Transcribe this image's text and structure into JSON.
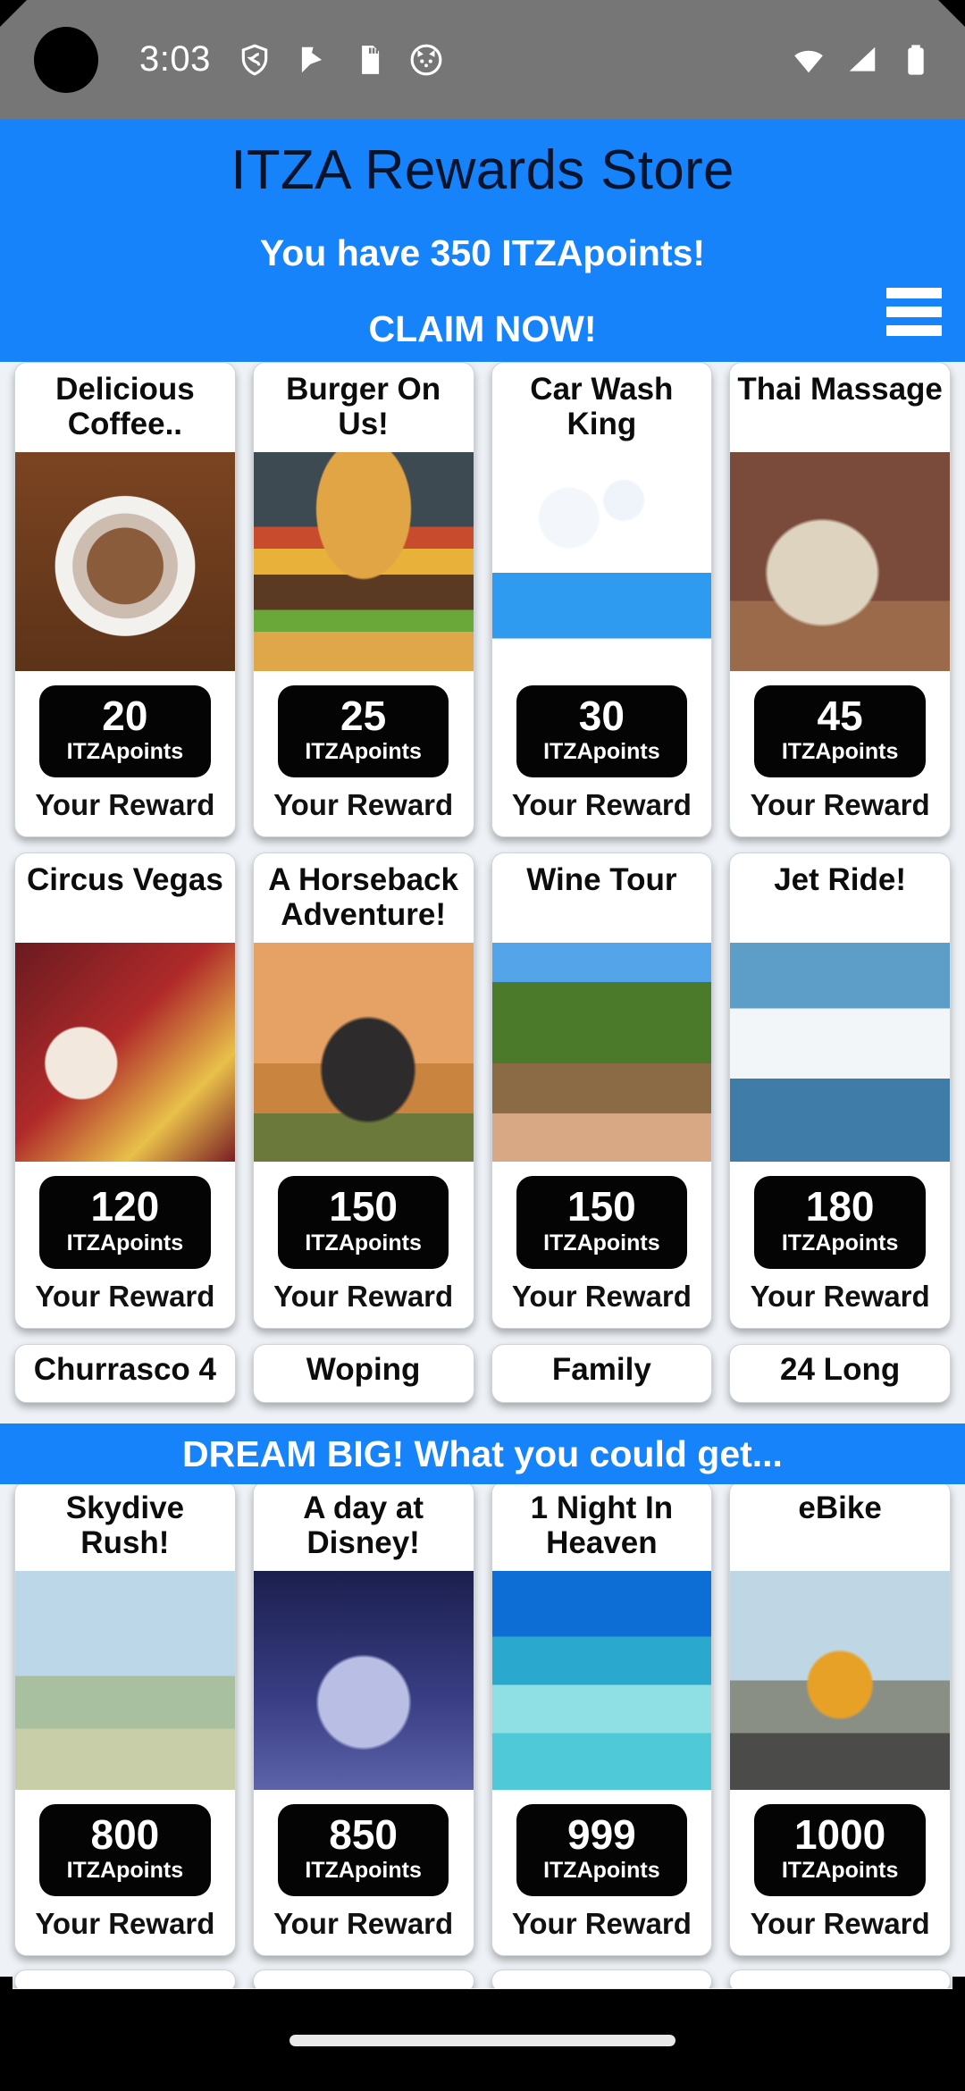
{
  "status_bar": {
    "time": "3:03",
    "left_icons": [
      "shield-icon",
      "flag-icon",
      "sd-card-icon",
      "cat-face-icon"
    ],
    "right_icons": [
      "wifi-icon",
      "cellular-signal-icon",
      "battery-icon"
    ]
  },
  "header": {
    "title": "ITZA Rewards Store",
    "points_line": "You have 350 ITZApoints!",
    "claim_label": "CLAIM NOW!",
    "menu_icon": "hamburger-menu-icon",
    "background_color": "#1683fb",
    "title_color": "#07142c"
  },
  "banner": {
    "text": "DREAM BIG! What you could get...",
    "background_color": "#1683fb"
  },
  "labels": {
    "points_unit": "ITZApoints",
    "reward_caption": "Your Reward"
  },
  "rewards_rows": [
    [
      {
        "title": "Delicious Coffee..",
        "points": "20",
        "unit": "ITZApoints",
        "caption": "Your Reward",
        "art": "g-coffee"
      },
      {
        "title": "Burger On Us!",
        "points": "25",
        "unit": "ITZApoints",
        "caption": "Your Reward",
        "art": "g-burger"
      },
      {
        "title": "Car Wash King",
        "points": "30",
        "unit": "ITZApoints",
        "caption": "Your Reward",
        "art": "g-carwash"
      },
      {
        "title": "Thai Massage",
        "points": "45",
        "unit": "ITZApoints",
        "caption": "Your Reward",
        "art": "g-massage"
      }
    ],
    [
      {
        "title": "Circus Vegas",
        "points": "120",
        "unit": "ITZApoints",
        "caption": "Your Reward",
        "art": "g-circus"
      },
      {
        "title": "A Horseback Adventure!",
        "points": "150",
        "unit": "ITZApoints",
        "caption": "Your Reward",
        "art": "g-horse"
      },
      {
        "title": "Wine Tour",
        "points": "150",
        "unit": "ITZApoints",
        "caption": "Your Reward",
        "art": "g-wine"
      },
      {
        "title": "Jet Ride!",
        "points": "180",
        "unit": "ITZApoints",
        "caption": "Your Reward",
        "art": "g-jet"
      }
    ]
  ],
  "rewards_partial_row": [
    {
      "title": "Churrasco 4"
    },
    {
      "title": "Woping"
    },
    {
      "title": "Family"
    },
    {
      "title": "24 Long"
    }
  ],
  "dream_rows": [
    [
      {
        "title": "Skydive Rush!",
        "points": "800",
        "unit": "ITZApoints",
        "caption": "Your Reward",
        "art": "g-sky"
      },
      {
        "title": "A day at Disney!",
        "points": "850",
        "unit": "ITZApoints",
        "caption": "Your Reward",
        "art": "g-disney"
      },
      {
        "title": "1 Night In Heaven",
        "points": "999",
        "unit": "ITZApoints",
        "caption": "Your Reward",
        "art": "g-beach"
      },
      {
        "title": "eBike",
        "points": "1000",
        "unit": "ITZApoints",
        "caption": "Your Reward",
        "art": "g-ebike"
      }
    ]
  ],
  "nav_bar": {
    "gesture_pill": "home-gesture-pill"
  }
}
